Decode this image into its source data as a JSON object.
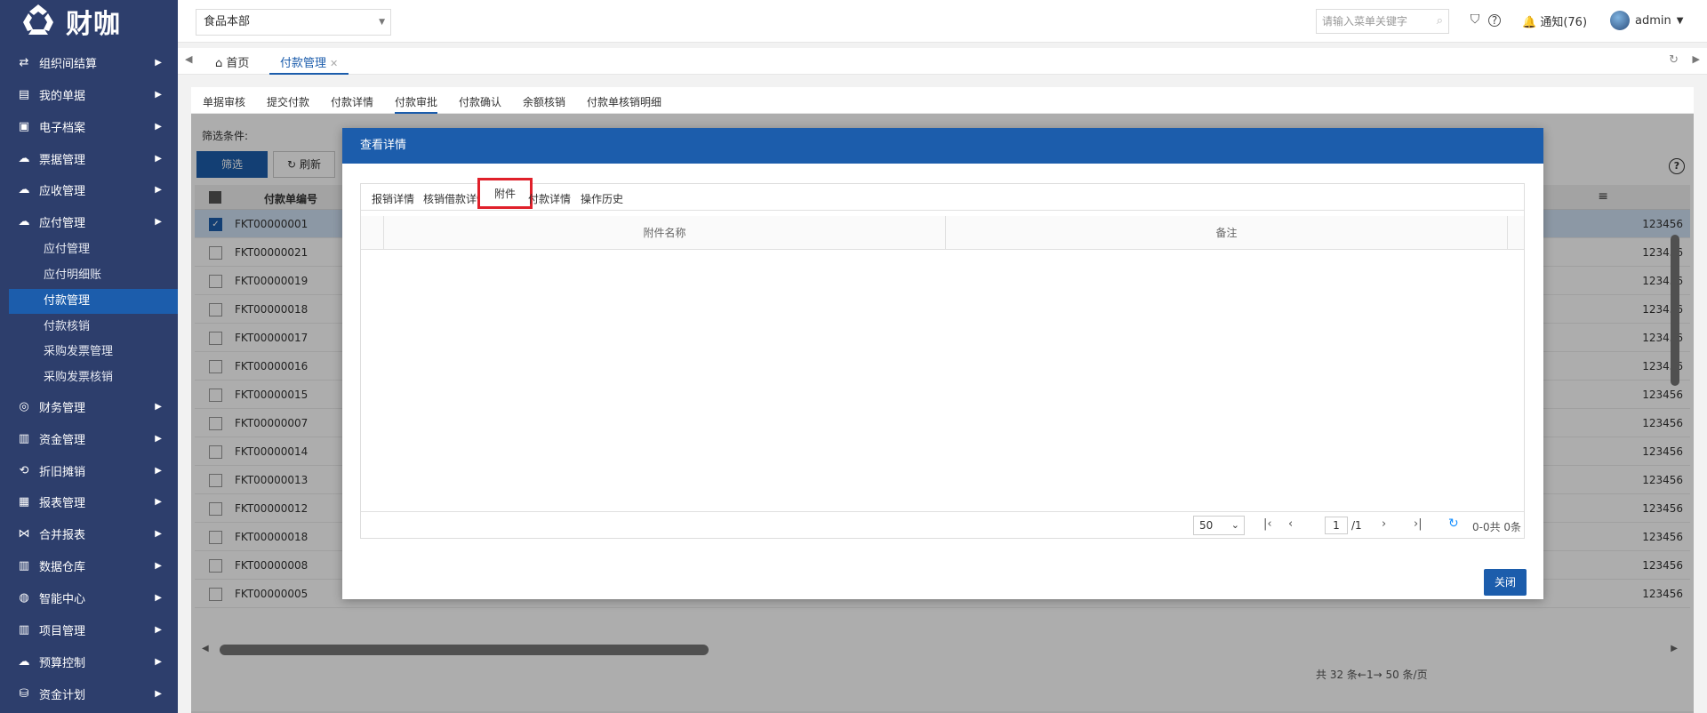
{
  "brand": {
    "name": "财咖"
  },
  "sidebar": {
    "items": [
      {
        "label": "组织间结算",
        "icon": "exchange-icon"
      },
      {
        "label": "我的单据",
        "icon": "document-icon"
      },
      {
        "label": "电子档案",
        "icon": "archive-icon"
      },
      {
        "label": "票据管理",
        "icon": "cloud-upload-icon"
      },
      {
        "label": "应收管理",
        "icon": "cloud-upload-icon"
      },
      {
        "label": "应付管理",
        "icon": "cloud-upload-icon"
      },
      {
        "label": "财务管理",
        "icon": "target-icon"
      },
      {
        "label": "资金管理",
        "icon": "bar-chart-icon"
      },
      {
        "label": "折旧摊销",
        "icon": "repeat-icon"
      },
      {
        "label": "报表管理",
        "icon": "report-icon"
      },
      {
        "label": "合并报表",
        "icon": "merge-icon"
      },
      {
        "label": "数据仓库",
        "icon": "bar-chart-icon"
      },
      {
        "label": "智能中心",
        "icon": "compass-icon"
      },
      {
        "label": "项目管理",
        "icon": "bar-chart-icon"
      },
      {
        "label": "预算控制",
        "icon": "cloud-upload-icon"
      },
      {
        "label": "资金计划",
        "icon": "database-icon"
      }
    ],
    "subitems": [
      {
        "label": "应付管理"
      },
      {
        "label": "应付明细账"
      },
      {
        "label": "付款管理",
        "active": true
      },
      {
        "label": "付款核销"
      },
      {
        "label": "采购发票管理"
      },
      {
        "label": "采购发票核销"
      }
    ]
  },
  "topbar": {
    "company": "食品本部",
    "search_placeholder": "请输入菜单关键字",
    "notify": "通知(76)",
    "user": "admin"
  },
  "tabs": {
    "home": "首页",
    "current": "付款管理"
  },
  "subtabs": [
    "单据审核",
    "提交付款",
    "付款详情",
    "付款审批",
    "付款确认",
    "余额核销",
    "付款单核销明细"
  ],
  "filter": {
    "label": "筛选条件:",
    "filter_btn": "筛选",
    "refresh_btn": "刷新"
  },
  "grid": {
    "header": "付款单编号",
    "rows": [
      {
        "code": "FKT00000001",
        "num": "123456"
      },
      {
        "code": "FKT00000021",
        "num": "123456"
      },
      {
        "code": "FKT00000019",
        "num": "123456"
      },
      {
        "code": "FKT00000018",
        "num": "123456"
      },
      {
        "code": "FKT00000017",
        "num": "123456"
      },
      {
        "code": "FKT00000016",
        "num": "123456"
      },
      {
        "code": "FKT00000015",
        "num": "123456"
      },
      {
        "code": "FKT00000007",
        "num": "123456"
      },
      {
        "code": "FKT00000014",
        "num": "123456"
      },
      {
        "code": "FKT00000013",
        "num": "123456"
      },
      {
        "code": "FKT00000012",
        "num": "123456"
      },
      {
        "code": "FKT00000018",
        "num": "123456"
      },
      {
        "code": "FKT00000008",
        "num": "123456"
      },
      {
        "code": "FKT00000005",
        "num": "123456"
      }
    ],
    "footer": "共 32 条←1→ 50 条/页"
  },
  "modal": {
    "title": "查看详情",
    "tabs": [
      "报销详情",
      "核销借款详情",
      "附件",
      "付款详情",
      "操作历史"
    ],
    "columns": [
      "附件名称",
      "备注"
    ],
    "page_size": "50",
    "page": "1",
    "total_pages": "/1",
    "info": "0-0共 0条",
    "close": "关闭"
  }
}
